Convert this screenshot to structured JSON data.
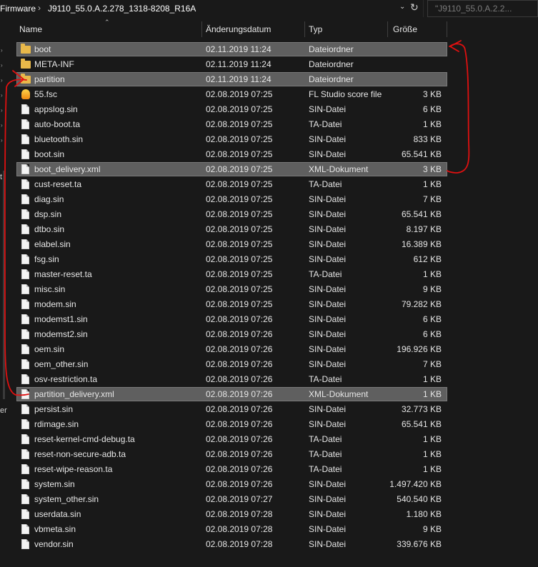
{
  "address_bar": {
    "crumbs": [
      "Firmware",
      "J9110_55.0.A.2.278_1318-8208_R16A"
    ],
    "separator": "›",
    "search_placeholder": "\"J9110_55.0.A.2.2..."
  },
  "nav": {
    "partial_letters": [
      "t",
      "er"
    ]
  },
  "columns": {
    "name": "Name",
    "date": "Änderungsdatum",
    "type": "Typ",
    "size": "Größe"
  },
  "files": [
    {
      "name": "boot",
      "date": "02.11.2019 11:24",
      "type": "Dateiordner",
      "size": "",
      "icon": "folder-icon",
      "selected": true
    },
    {
      "name": "META-INF",
      "date": "02.11.2019 11:24",
      "type": "Dateiordner",
      "size": "",
      "icon": "folder-icon",
      "selected": false
    },
    {
      "name": "partition",
      "date": "02.11.2019 11:24",
      "type": "Dateiordner",
      "size": "",
      "icon": "folder-icon",
      "selected": true
    },
    {
      "name": "55.fsc",
      "date": "02.08.2019 07:25",
      "type": "FL Studio score file",
      "size": "3 KB",
      "icon": "fl-studio-icon",
      "selected": false
    },
    {
      "name": "appslog.sin",
      "date": "02.08.2019 07:25",
      "type": "SIN-Datei",
      "size": "6 KB",
      "icon": "file-icon",
      "selected": false
    },
    {
      "name": "auto-boot.ta",
      "date": "02.08.2019 07:25",
      "type": "TA-Datei",
      "size": "1 KB",
      "icon": "file-icon",
      "selected": false
    },
    {
      "name": "bluetooth.sin",
      "date": "02.08.2019 07:25",
      "type": "SIN-Datei",
      "size": "833 KB",
      "icon": "file-icon",
      "selected": false
    },
    {
      "name": "boot.sin",
      "date": "02.08.2019 07:25",
      "type": "SIN-Datei",
      "size": "65.541 KB",
      "icon": "file-icon",
      "selected": false
    },
    {
      "name": "boot_delivery.xml",
      "date": "02.08.2019 07:25",
      "type": "XML-Dokument",
      "size": "3 KB",
      "icon": "file-icon",
      "selected": true
    },
    {
      "name": "cust-reset.ta",
      "date": "02.08.2019 07:25",
      "type": "TA-Datei",
      "size": "1 KB",
      "icon": "file-icon",
      "selected": false
    },
    {
      "name": "diag.sin",
      "date": "02.08.2019 07:25",
      "type": "SIN-Datei",
      "size": "7 KB",
      "icon": "file-icon",
      "selected": false
    },
    {
      "name": "dsp.sin",
      "date": "02.08.2019 07:25",
      "type": "SIN-Datei",
      "size": "65.541 KB",
      "icon": "file-icon",
      "selected": false
    },
    {
      "name": "dtbo.sin",
      "date": "02.08.2019 07:25",
      "type": "SIN-Datei",
      "size": "8.197 KB",
      "icon": "file-icon",
      "selected": false
    },
    {
      "name": "elabel.sin",
      "date": "02.08.2019 07:25",
      "type": "SIN-Datei",
      "size": "16.389 KB",
      "icon": "file-icon",
      "selected": false
    },
    {
      "name": "fsg.sin",
      "date": "02.08.2019 07:25",
      "type": "SIN-Datei",
      "size": "612 KB",
      "icon": "file-icon",
      "selected": false
    },
    {
      "name": "master-reset.ta",
      "date": "02.08.2019 07:25",
      "type": "TA-Datei",
      "size": "1 KB",
      "icon": "file-icon",
      "selected": false
    },
    {
      "name": "misc.sin",
      "date": "02.08.2019 07:25",
      "type": "SIN-Datei",
      "size": "9 KB",
      "icon": "file-icon",
      "selected": false
    },
    {
      "name": "modem.sin",
      "date": "02.08.2019 07:25",
      "type": "SIN-Datei",
      "size": "79.282 KB",
      "icon": "file-icon",
      "selected": false
    },
    {
      "name": "modemst1.sin",
      "date": "02.08.2019 07:26",
      "type": "SIN-Datei",
      "size": "6 KB",
      "icon": "file-icon",
      "selected": false
    },
    {
      "name": "modemst2.sin",
      "date": "02.08.2019 07:26",
      "type": "SIN-Datei",
      "size": "6 KB",
      "icon": "file-icon",
      "selected": false
    },
    {
      "name": "oem.sin",
      "date": "02.08.2019 07:26",
      "type": "SIN-Datei",
      "size": "196.926 KB",
      "icon": "file-icon",
      "selected": false
    },
    {
      "name": "oem_other.sin",
      "date": "02.08.2019 07:26",
      "type": "SIN-Datei",
      "size": "7 KB",
      "icon": "file-icon",
      "selected": false
    },
    {
      "name": "osv-restriction.ta",
      "date": "02.08.2019 07:26",
      "type": "TA-Datei",
      "size": "1 KB",
      "icon": "file-icon",
      "selected": false
    },
    {
      "name": "partition_delivery.xml",
      "date": "02.08.2019 07:26",
      "type": "XML-Dokument",
      "size": "1 KB",
      "icon": "file-icon",
      "selected": true
    },
    {
      "name": "persist.sin",
      "date": "02.08.2019 07:26",
      "type": "SIN-Datei",
      "size": "32.773 KB",
      "icon": "file-icon",
      "selected": false
    },
    {
      "name": "rdimage.sin",
      "date": "02.08.2019 07:26",
      "type": "SIN-Datei",
      "size": "65.541 KB",
      "icon": "file-icon",
      "selected": false
    },
    {
      "name": "reset-kernel-cmd-debug.ta",
      "date": "02.08.2019 07:26",
      "type": "TA-Datei",
      "size": "1 KB",
      "icon": "file-icon",
      "selected": false
    },
    {
      "name": "reset-non-secure-adb.ta",
      "date": "02.08.2019 07:26",
      "type": "TA-Datei",
      "size": "1 KB",
      "icon": "file-icon",
      "selected": false
    },
    {
      "name": "reset-wipe-reason.ta",
      "date": "02.08.2019 07:26",
      "type": "TA-Datei",
      "size": "1 KB",
      "icon": "file-icon",
      "selected": false
    },
    {
      "name": "system.sin",
      "date": "02.08.2019 07:26",
      "type": "SIN-Datei",
      "size": "1.497.420 KB",
      "icon": "file-icon",
      "selected": false
    },
    {
      "name": "system_other.sin",
      "date": "02.08.2019 07:27",
      "type": "SIN-Datei",
      "size": "540.540 KB",
      "icon": "file-icon",
      "selected": false
    },
    {
      "name": "userdata.sin",
      "date": "02.08.2019 07:28",
      "type": "SIN-Datei",
      "size": "1.180 KB",
      "icon": "file-icon",
      "selected": false
    },
    {
      "name": "vbmeta.sin",
      "date": "02.08.2019 07:28",
      "type": "SIN-Datei",
      "size": "9 KB",
      "icon": "file-icon",
      "selected": false
    },
    {
      "name": "vendor.sin",
      "date": "02.08.2019 07:28",
      "type": "SIN-Datei",
      "size": "339.676 KB",
      "icon": "file-icon",
      "selected": false
    }
  ],
  "colors": {
    "background": "#191919",
    "selection": "#5f5f5f",
    "annotation": "#e01010",
    "folder": "#e8b84a"
  }
}
